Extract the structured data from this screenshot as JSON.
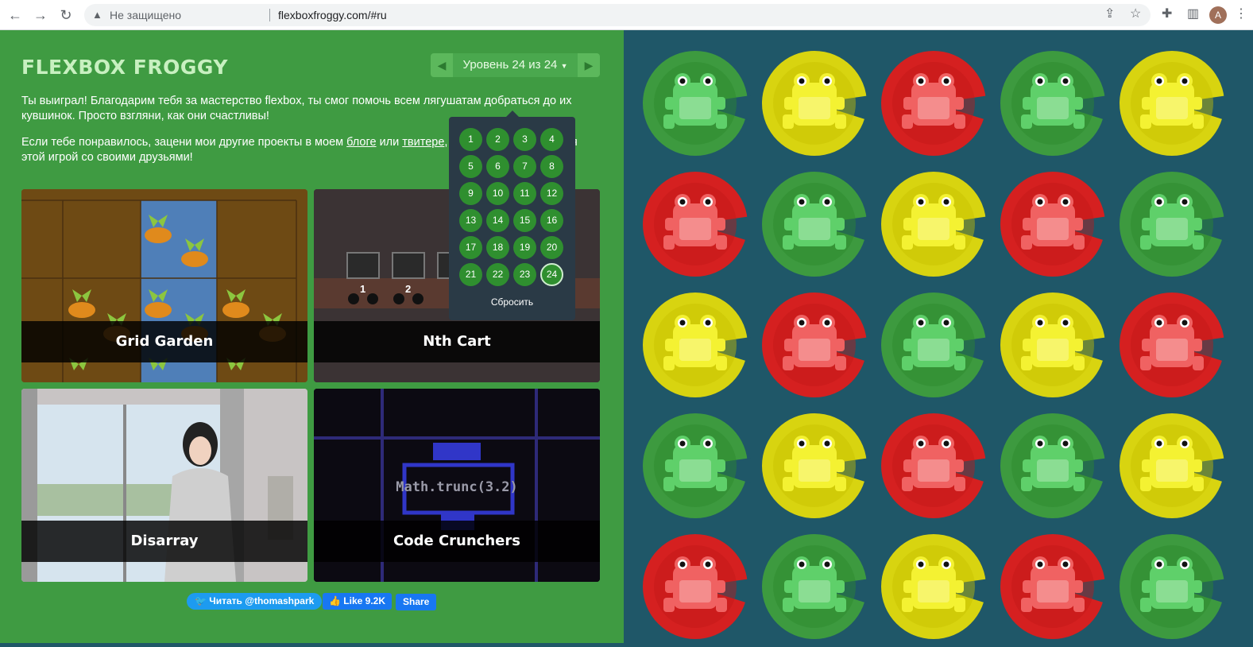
{
  "browser": {
    "address_status": "Не защищено",
    "url": "flexboxfroggy.com/#ru",
    "avatar_letter": "A"
  },
  "app": {
    "logo": "FLEXBOX FROGGY",
    "level_label": "Уровень 24 из 24",
    "current_level": 24,
    "intro_1": "Ты выиграл! Благодарим тебя за мастерство flexbox, ты смог помочь всем лягушатам добраться до их кувшинок. Просто взгляни, как они счастливы!",
    "intro_2_pre": "Если тебе понравилось, зацени мои другие проекты в моем ",
    "intro_2_link1": "блоге",
    "intro_2_mid": " или ",
    "intro_2_link2": "твитере",
    "intro_2_post": ", и не забудь поделиться этой игрой со своими друзьями!",
    "projects": [
      "Grid Garden",
      "Nth Cart",
      "Disarray",
      "Code Crunchers"
    ],
    "code_crunchers_code": "Math.trunc(3.2)",
    "nth_cart_numbers": [
      "1",
      "2"
    ],
    "twitter_button": "Читать @thomashpark",
    "fb_like": "Like 9.2K",
    "fb_share": "Share"
  },
  "dropdown": {
    "levels": [
      "1",
      "2",
      "3",
      "4",
      "5",
      "6",
      "7",
      "8",
      "9",
      "10",
      "11",
      "12",
      "13",
      "14",
      "15",
      "16",
      "17",
      "18",
      "19",
      "20",
      "21",
      "22",
      "23",
      "24"
    ],
    "reset_label": "Сбросить"
  },
  "colors": {
    "green": "#3d9a3f",
    "green_pad": "#2d8a2d",
    "green_frog": "#5fd06a",
    "yellow": "#d8d410",
    "yellow_pad": "#c8c000",
    "yellow_frog": "#f4f232",
    "red": "#d52020",
    "red_pad": "#c01818",
    "red_frog": "#f06262",
    "pond": "#1f5768"
  },
  "pond": {
    "rows": [
      [
        "green",
        "yellow",
        "red",
        "green",
        "yellow"
      ],
      [
        "red",
        "green",
        "yellow",
        "red",
        "green"
      ],
      [
        "yellow",
        "red",
        "green",
        "yellow",
        "red"
      ],
      [
        "green",
        "yellow",
        "red",
        "green",
        "yellow"
      ],
      [
        "red",
        "green",
        "yellow",
        "red",
        "green"
      ]
    ]
  }
}
